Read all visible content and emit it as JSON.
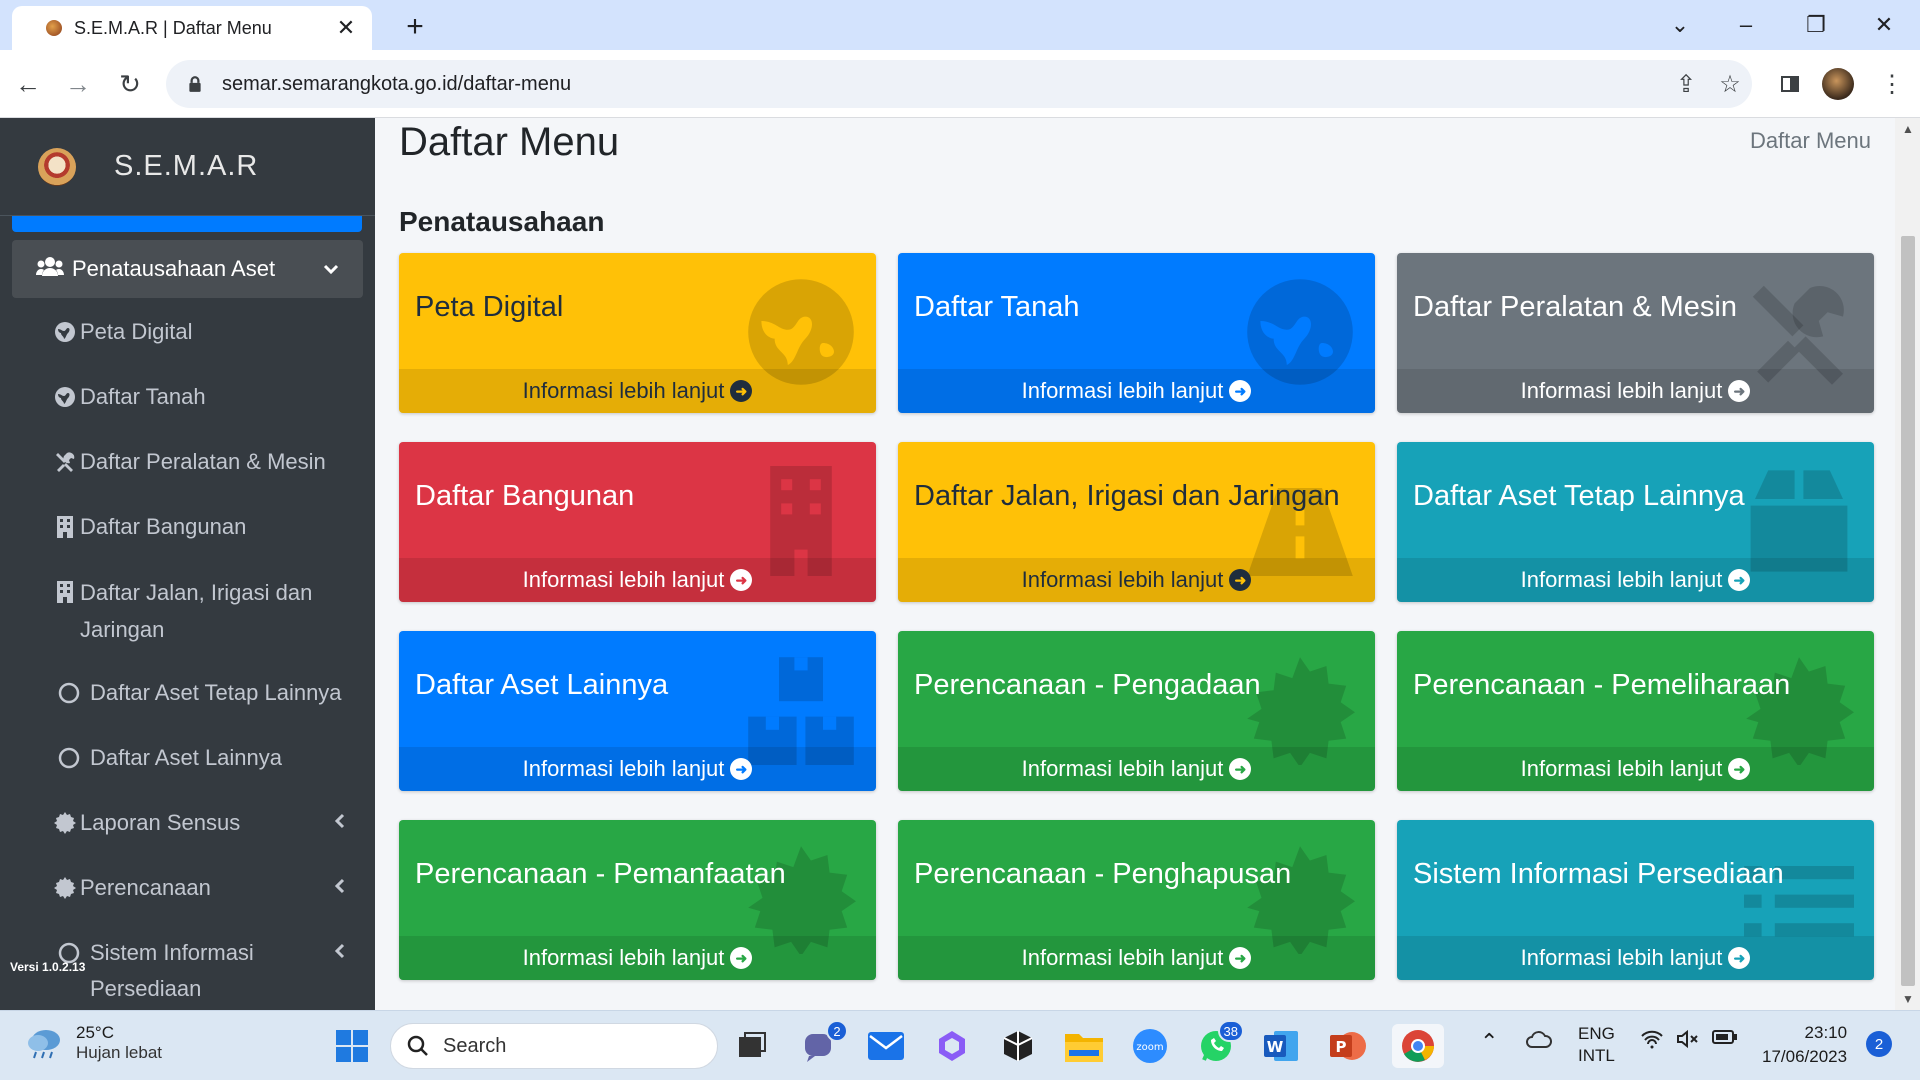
{
  "browser": {
    "tab_title": "S.E.M.A.R | Daftar Menu",
    "url": "semar.semarangkota.go.id/daftar-menu"
  },
  "sidebar": {
    "brand": "S.E.M.A.R",
    "active_group": "Penatausahaan Aset",
    "items": [
      {
        "label": "Peta Digital",
        "icon": "globe-icon"
      },
      {
        "label": "Daftar Tanah",
        "icon": "globe-icon"
      },
      {
        "label": "Daftar Peralatan & Mesin",
        "icon": "tools-icon"
      },
      {
        "label": "Daftar Bangunan",
        "icon": "building-icon"
      },
      {
        "label": "Daftar Jalan, Irigasi dan Jaringan",
        "icon": "building-icon"
      },
      {
        "label": "Daftar Aset Tetap Lainnya",
        "icon": "circle-icon"
      },
      {
        "label": "Daftar Aset Lainnya",
        "icon": "circle-icon"
      },
      {
        "label": "Laporan Sensus",
        "icon": "gear-icon"
      },
      {
        "label": "Perencanaan",
        "icon": "gear-icon"
      },
      {
        "label": "Sistem Informasi Persediaan",
        "icon": "circle-icon"
      }
    ],
    "version": "Versi 1.0.2.13"
  },
  "main": {
    "page_title": "Daftar Menu",
    "breadcrumb": "Daftar Menu",
    "section_title": "Penatausahaan",
    "card_link": "Informasi lebih lanjut",
    "cards": [
      {
        "title": "Peta Digital",
        "color": "#ffc107",
        "icon": "globe-icon"
      },
      {
        "title": "Daftar Tanah",
        "color": "#007bff",
        "icon": "globe-icon"
      },
      {
        "title": "Daftar Peralatan & Mesin",
        "color": "#6c757d",
        "icon": "tools-icon"
      },
      {
        "title": "Daftar Bangunan",
        "color": "#dc3545",
        "icon": "building-icon"
      },
      {
        "title": "Daftar Jalan, Irigasi dan Jaringan",
        "color": "#ffc107",
        "icon": "road-icon"
      },
      {
        "title": "Daftar Aset Tetap Lainnya",
        "color": "#17a2b8",
        "icon": "box-icon"
      },
      {
        "title": "Daftar Aset Lainnya",
        "color": "#007bff",
        "icon": "boxes-icon"
      },
      {
        "title": "Perencanaan - Pengadaan",
        "color": "#28a745",
        "icon": "certificate-icon"
      },
      {
        "title": "Perencanaan - Pemeliharaan",
        "color": "#28a745",
        "icon": "certificate-icon"
      },
      {
        "title": "Perencanaan - Pemanfaatan",
        "color": "#28a745",
        "icon": "certificate-icon"
      },
      {
        "title": "Perencanaan - Penghapusan",
        "color": "#28a745",
        "icon": "certificate-icon"
      },
      {
        "title": "Sistem Informasi Persediaan",
        "color": "#17a2b8",
        "icon": "list-icon"
      }
    ]
  },
  "taskbar": {
    "weather_temp": "25°C",
    "weather_desc": "Hujan lebat",
    "search_label": "Search",
    "teams_badge": "2",
    "whatsapp_badge": "38",
    "lang_1": "ENG",
    "lang_2": "INTL",
    "time": "23:10",
    "date": "17/06/2023",
    "notifications": "2"
  }
}
